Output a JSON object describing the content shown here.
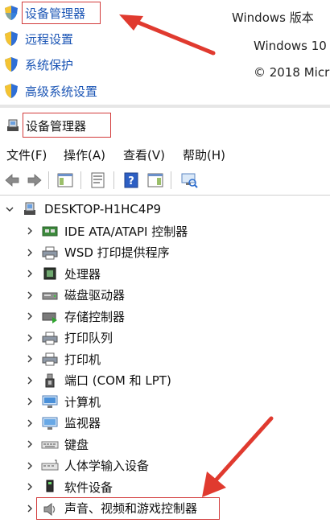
{
  "sidebar": {
    "items": [
      {
        "label": "设备管理器"
      },
      {
        "label": "远程设置"
      },
      {
        "label": "系统保护"
      },
      {
        "label": "高级系统设置"
      }
    ]
  },
  "windows_info": {
    "edition_label": "Windows 版本",
    "product": "Windows 10",
    "copyright": "© 2018 Micr"
  },
  "device_manager": {
    "title": "设备管理器",
    "menu": [
      {
        "label": "文件(F)"
      },
      {
        "label": "操作(A)"
      },
      {
        "label": "查看(V)"
      },
      {
        "label": "帮助(H)"
      }
    ],
    "root": {
      "label": "DESKTOP-H1HC4P9"
    },
    "categories": [
      {
        "label": "IDE ATA/ATAPI 控制器",
        "icon": "ide-controller-icon"
      },
      {
        "label": "WSD 打印提供程序",
        "icon": "printer-icon"
      },
      {
        "label": "处理器",
        "icon": "processor-icon"
      },
      {
        "label": "磁盘驱动器",
        "icon": "disk-drive-icon"
      },
      {
        "label": "存储控制器",
        "icon": "storage-controller-icon"
      },
      {
        "label": "打印队列",
        "icon": "print-queue-icon"
      },
      {
        "label": "打印机",
        "icon": "printer-icon"
      },
      {
        "label": "端口 (COM 和 LPT)",
        "icon": "port-icon"
      },
      {
        "label": "计算机",
        "icon": "computer-icon"
      },
      {
        "label": "监视器",
        "icon": "monitor-icon"
      },
      {
        "label": "键盘",
        "icon": "keyboard-icon"
      },
      {
        "label": "人体学输入设备",
        "icon": "hid-icon"
      },
      {
        "label": "软件设备",
        "icon": "software-device-icon"
      },
      {
        "label": "声音、视频和游戏控制器",
        "icon": "speaker-icon"
      }
    ]
  },
  "colors": {
    "link_blue": "#1b55b5",
    "highlight_red": "#d23b3b"
  }
}
